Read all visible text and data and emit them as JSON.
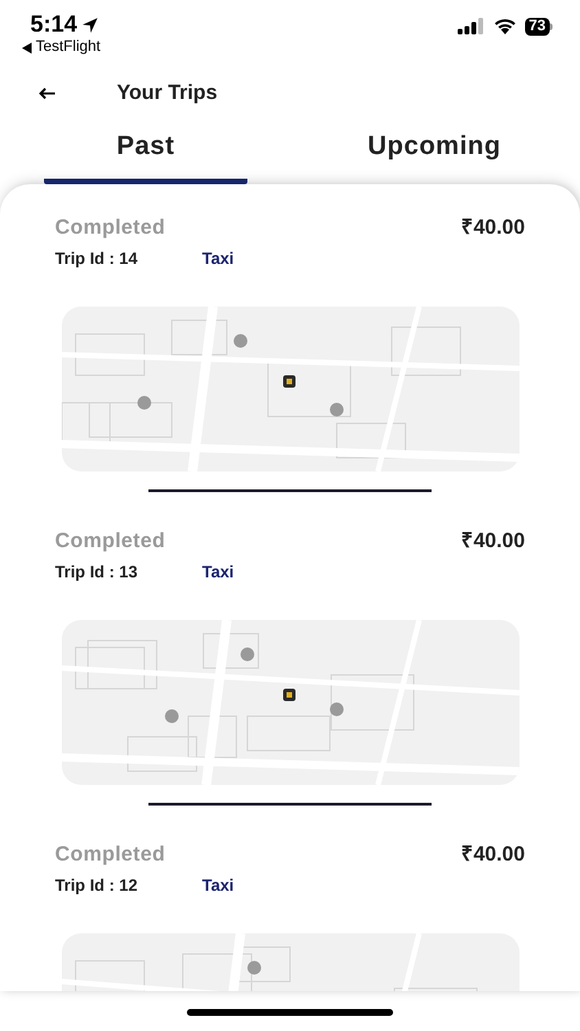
{
  "status_bar": {
    "time": "5:14",
    "back_app": "TestFlight",
    "battery": "73"
  },
  "header": {
    "title": "Your Trips"
  },
  "tabs": [
    {
      "label": "Past",
      "selected": true
    },
    {
      "label": "Upcoming",
      "selected": false
    }
  ],
  "trips": [
    {
      "status": "Completed",
      "fare": "₹40.00",
      "trip_id": "Trip Id : 14",
      "service": "Taxi"
    },
    {
      "status": "Completed",
      "fare": "₹40.00",
      "trip_id": "Trip Id : 13",
      "service": "Taxi"
    },
    {
      "status": "Completed",
      "fare": "₹40.00",
      "trip_id": "Trip Id : 12",
      "service": "Taxi"
    }
  ]
}
